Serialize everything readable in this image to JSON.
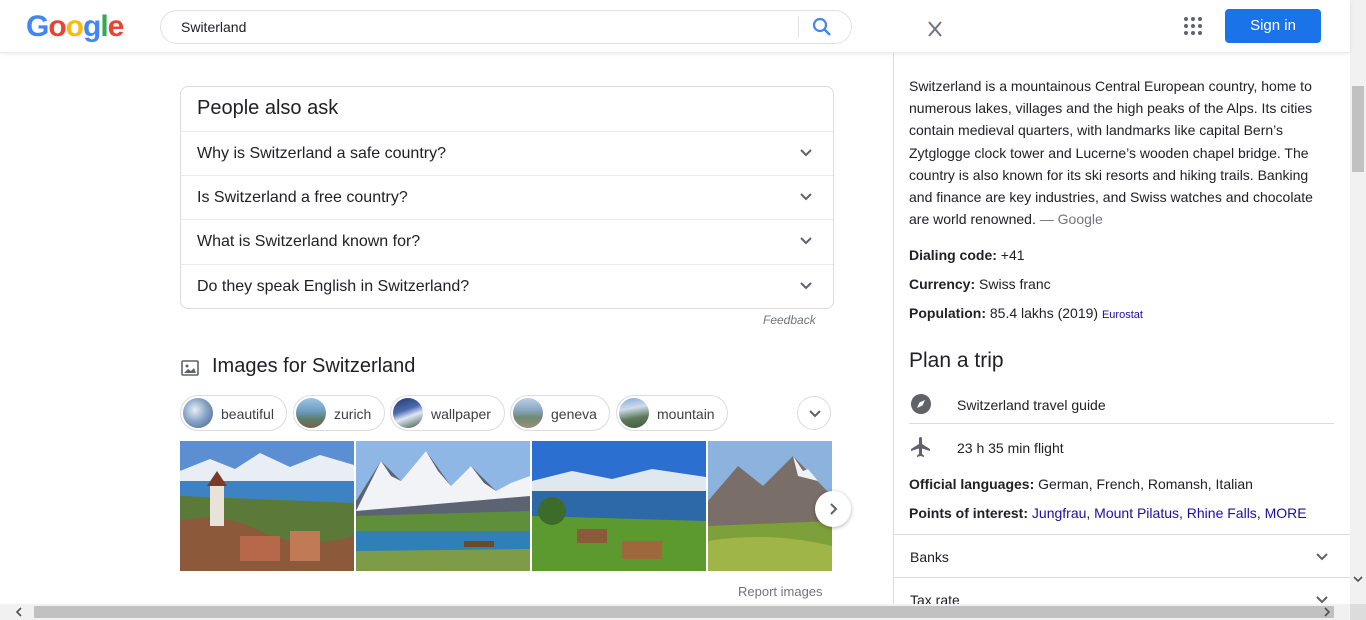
{
  "header": {
    "logo": [
      "G",
      "o",
      "o",
      "g",
      "l",
      "e"
    ],
    "logo_colors": [
      "#4285F4",
      "#EA4335",
      "#FBBC05",
      "#4285F4",
      "#34A853",
      "#EA4335"
    ],
    "search_value": "Switerland",
    "signin_label": "Sign in",
    "icons": {
      "clear": "close-icon",
      "search": "search-icon",
      "apps": "apps-grid-icon"
    }
  },
  "main": {
    "cut_text": "...",
    "people_also_ask": {
      "title": "People also ask",
      "questions": [
        "Why is Switzerland a safe country?",
        "Is Switzerland a free country?",
        "What is Switzerland known for?",
        "Do they speak English in Switzerland?"
      ]
    },
    "feedback": "Feedback",
    "images": {
      "title": "Images for Switzerland",
      "chips": [
        "beautiful",
        "zurich",
        "wallpaper",
        "geneva",
        "mountain"
      ],
      "report": "Report images"
    }
  },
  "knowledge_panel": {
    "description": "Switzerland is a mountainous Central European country, home to numerous lakes, villages and the high peaks of the Alps. Its cities contain medieval quarters, with landmarks like capital Bern’s Zytglogge clock tower and Lucerne’s wooden chapel bridge. The country is also known for its ski resorts and hiking trails. Banking and finance are key industries, and Swiss watches and chocolate are world renowned.",
    "description_source": "— Google",
    "dialing_code": {
      "label": "Dialing code:",
      "value": "+41"
    },
    "currency": {
      "label": "Currency:",
      "value": "Swiss franc"
    },
    "population": {
      "label": "Population:",
      "value": "85.4 lakhs (2019)",
      "source": "Eurostat"
    },
    "plan_trip": {
      "title": "Plan a trip",
      "items": [
        {
          "icon": "compass-icon",
          "label": "Switzerland travel guide"
        },
        {
          "icon": "airplane-icon",
          "label": "23 h 35 min flight"
        }
      ]
    },
    "languages": {
      "label": "Official languages:",
      "value": "German, French, Romansh, Italian"
    },
    "points_of_interest": {
      "label": "Points of interest:",
      "items": [
        "Jungfrau",
        "Mount Pilatus",
        "Rhine Falls"
      ],
      "more": "MORE"
    },
    "accordions": [
      "Banks",
      "Tax rate"
    ]
  }
}
